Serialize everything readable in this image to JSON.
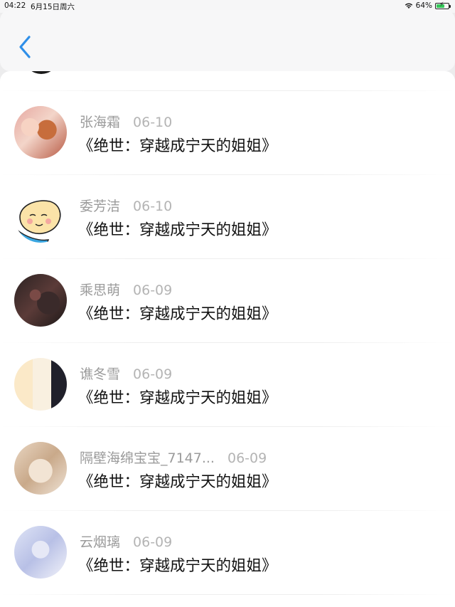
{
  "status_bar": {
    "time": "04:22",
    "date": "6月15日周六",
    "battery_text": "64%",
    "battery_level": 0.64
  },
  "nav": {
    "back_icon": "chevron-left-icon",
    "accent": "#2f8fe8"
  },
  "list": {
    "items": [
      {
        "name": "张海霜",
        "date": "06-10",
        "title": "《绝世：穿越成宁天的姐姐》"
      },
      {
        "name": "委芳洁",
        "date": "06-10",
        "title": "《绝世：穿越成宁天的姐姐》"
      },
      {
        "name": "乘思萌",
        "date": "06-09",
        "title": "《绝世：穿越成宁天的姐姐》"
      },
      {
        "name": "谯冬雪",
        "date": "06-09",
        "title": "《绝世：穿越成宁天的姐姐》"
      },
      {
        "name": "隔壁海绵宝宝_7147...",
        "date": "06-09",
        "title": "《绝世：穿越成宁天的姐姐》"
      },
      {
        "name": "云烟璃",
        "date": "06-09",
        "title": "《绝世：穿越成宁天的姐姐》"
      }
    ]
  }
}
